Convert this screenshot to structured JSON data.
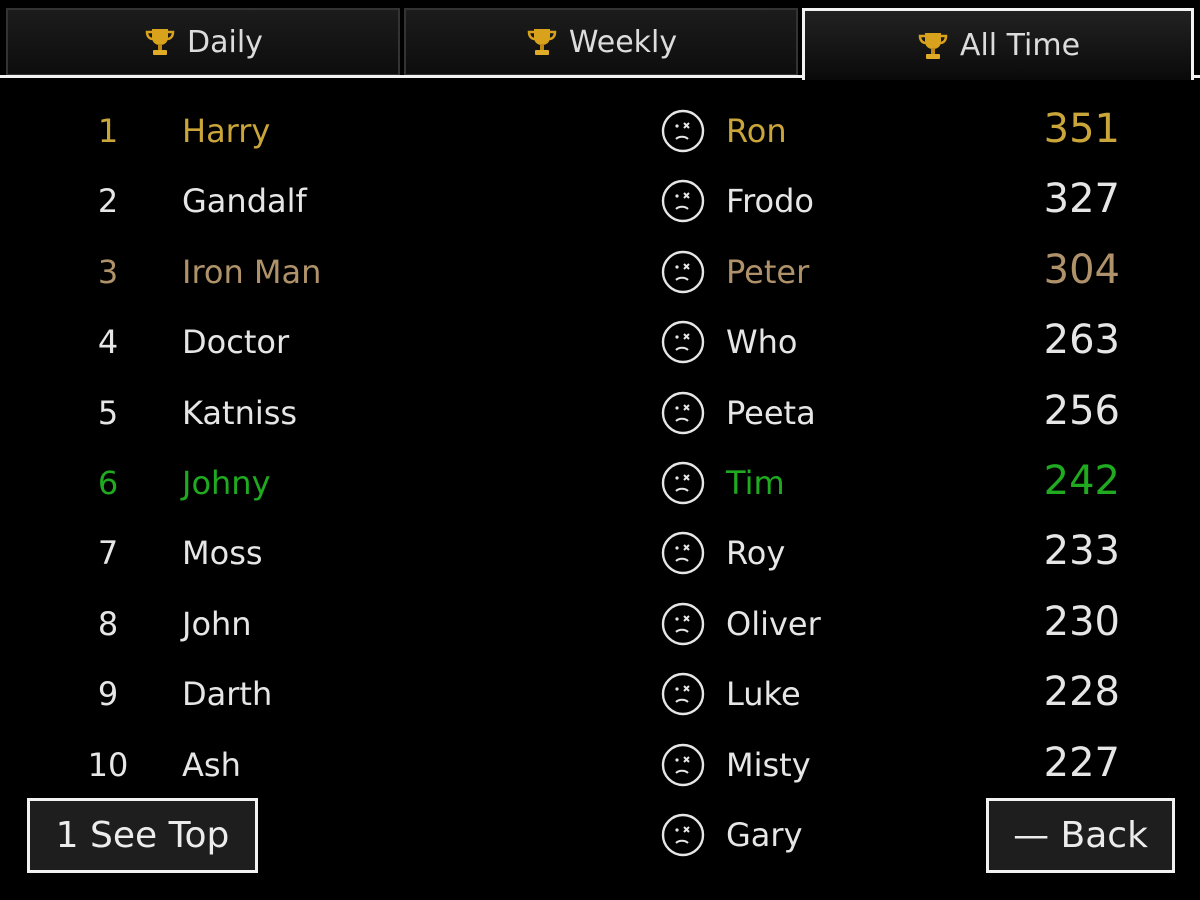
{
  "tabs": [
    {
      "label": "Daily",
      "icon": "trophy-icon"
    },
    {
      "label": "Weekly",
      "icon": "trophy-icon"
    },
    {
      "label": "All Time",
      "icon": "trophy-icon",
      "selected": true
    }
  ],
  "colors": {
    "gold": "#c9a53a",
    "bronze": "#b0926a",
    "green": "#1faa1f",
    "default": "#e6e6e6"
  },
  "leaderboard": [
    {
      "rank": "1",
      "name": "Harry",
      "opponent": "Ron",
      "score": "351",
      "color": "#c9a53a"
    },
    {
      "rank": "2",
      "name": "Gandalf",
      "opponent": "Frodo",
      "score": "327",
      "color": "#e6e6e6"
    },
    {
      "rank": "3",
      "name": "Iron Man",
      "opponent": "Peter",
      "score": "304",
      "color": "#b0926a"
    },
    {
      "rank": "4",
      "name": "Doctor",
      "opponent": "Who",
      "score": "263",
      "color": "#e6e6e6"
    },
    {
      "rank": "5",
      "name": "Katniss",
      "opponent": "Peeta",
      "score": "256",
      "color": "#e6e6e6"
    },
    {
      "rank": "6",
      "name": "Johny",
      "opponent": "Tim",
      "score": "242",
      "color": "#1faa1f"
    },
    {
      "rank": "7",
      "name": "Moss",
      "opponent": "Roy",
      "score": "233",
      "color": "#e6e6e6"
    },
    {
      "rank": "8",
      "name": "John",
      "opponent": "Oliver",
      "score": "230",
      "color": "#e6e6e6"
    },
    {
      "rank": "9",
      "name": "Darth",
      "opponent": "Luke",
      "score": "228",
      "color": "#e6e6e6"
    },
    {
      "rank": "10",
      "name": "Ash",
      "opponent": "Misty",
      "score": "227",
      "color": "#e6e6e6"
    },
    {
      "rank": "",
      "name": "",
      "opponent": "Gary",
      "score": "",
      "color": "#e6e6e6"
    }
  ],
  "buttons": {
    "see_top": "1 See Top",
    "back": "— Back"
  }
}
